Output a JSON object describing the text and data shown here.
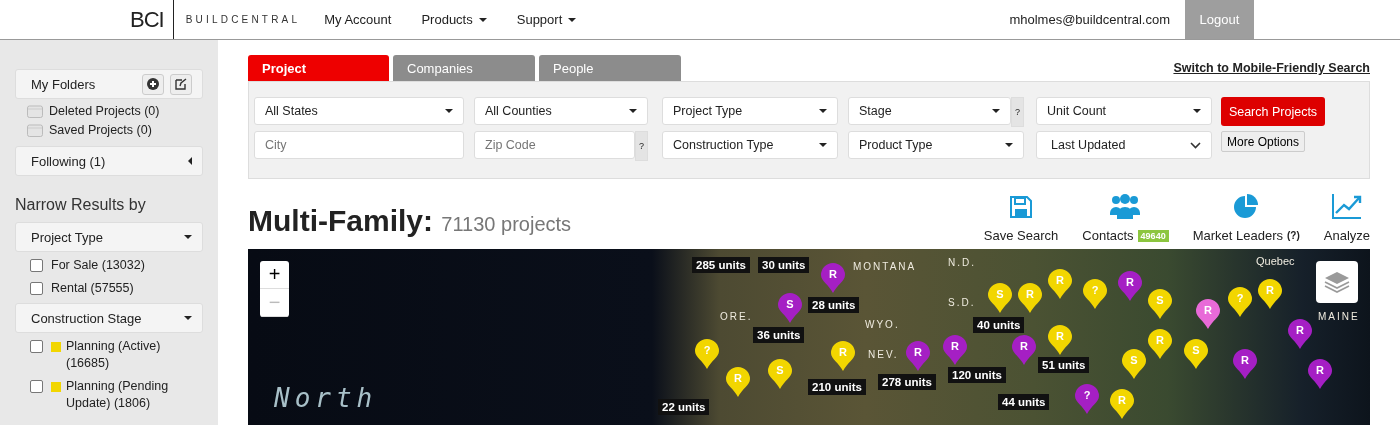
{
  "header": {
    "logo_mark": "BCI",
    "logo_text": "BUILDCENTRAL",
    "nav": [
      {
        "label": "My Account",
        "dropdown": false
      },
      {
        "label": "Products",
        "dropdown": true
      },
      {
        "label": "Support",
        "dropdown": true
      }
    ],
    "user": "mholmes@buildcentral.com",
    "logout": "Logout"
  },
  "sidebar": {
    "folders": {
      "title": "My Folders",
      "items": [
        "Deleted Projects (0)",
        "Saved Projects (0)"
      ]
    },
    "following": {
      "label": "Following (1)",
      "expanded": false
    },
    "narrow_title": "Narrow Results by",
    "groups": [
      {
        "title": "Project Type",
        "options": [
          {
            "label": "For Sale (13032)",
            "checked": false
          },
          {
            "label": "Rental (57555)",
            "checked": false
          }
        ]
      },
      {
        "title": "Construction Stage",
        "options": [
          {
            "label": "Planning (Active) (16685)",
            "checked": false,
            "color": "#f2d600"
          },
          {
            "label": "Planning (Pending Update) (1806)",
            "checked": false,
            "color": "#f2d600"
          }
        ]
      }
    ]
  },
  "tabs": [
    {
      "label": "Project",
      "selected": true
    },
    {
      "label": "Companies",
      "selected": false
    },
    {
      "label": "People",
      "selected": false
    }
  ],
  "mobile_link": "Switch to Mobile-Friendly Search",
  "filters": [
    [
      {
        "kind": "select",
        "value": "All States"
      },
      {
        "kind": "select",
        "value": "All Counties"
      },
      {
        "kind": "select",
        "value": "Project Type"
      },
      {
        "kind": "select",
        "value": "Stage",
        "help": "?"
      },
      {
        "kind": "select",
        "value": "Unit Count"
      }
    ],
    [
      {
        "kind": "input",
        "placeholder": "City"
      },
      {
        "kind": "input",
        "placeholder": "Zip Code",
        "help": "?"
      },
      {
        "kind": "select",
        "value": "Construction Type"
      },
      {
        "kind": "select",
        "value": "Product Type"
      },
      {
        "kind": "native",
        "value": "Last Updated"
      }
    ]
  ],
  "search_button": "Search Projects",
  "more_options": "More Options",
  "results": {
    "title": "Multi-Family:",
    "count": "71130 projects"
  },
  "actions": [
    {
      "kind": "save",
      "label": "Save Search"
    },
    {
      "kind": "contacts",
      "label": "Contacts",
      "badge": "49640"
    },
    {
      "kind": "leaders",
      "label": "Market Leaders",
      "hint": "(?)"
    },
    {
      "kind": "analyze",
      "label": "Analyze"
    }
  ],
  "map": {
    "zoom_in": "+",
    "zoom_out": "−",
    "places": [
      {
        "text": "North",
        "kind": "ocean"
      },
      {
        "text": "MONTANA",
        "kind": "state"
      },
      {
        "text": "N.D.",
        "kind": "state"
      },
      {
        "text": "S.D.",
        "kind": "state"
      },
      {
        "text": "WYO.",
        "kind": "state"
      },
      {
        "text": "NEV.",
        "kind": "state"
      },
      {
        "text": "ORE.",
        "kind": "state"
      },
      {
        "text": "Quebec",
        "kind": "city"
      },
      {
        "text": "MAINE",
        "kind": "state"
      }
    ],
    "labels": [
      "285 units",
      "30 units",
      "28 units",
      "36 units",
      "120 units",
      "44 units",
      "51 units",
      "278 units",
      "210 units",
      "22 units",
      "40 units"
    ],
    "pins": [
      {
        "letter": "?",
        "color": "#f2d600"
      },
      {
        "letter": "R",
        "color": "#a51fc4"
      },
      {
        "letter": "S",
        "color": "#a51fc4"
      },
      {
        "letter": "R",
        "color": "#f2d600"
      },
      {
        "letter": "R",
        "color": "#a51fc4"
      },
      {
        "letter": "R",
        "color": "#a51fc4"
      },
      {
        "letter": "S",
        "color": "#f2d600"
      },
      {
        "letter": "R",
        "color": "#f2d600"
      },
      {
        "letter": "R",
        "color": "#f2d600"
      },
      {
        "letter": "?",
        "color": "#f2d600"
      },
      {
        "letter": "R",
        "color": "#a51fc4"
      },
      {
        "letter": "S",
        "color": "#f2d600"
      },
      {
        "letter": "R",
        "color": "#e86ad8"
      },
      {
        "letter": "?",
        "color": "#f2d600"
      },
      {
        "letter": "R",
        "color": "#f2d600"
      },
      {
        "letter": "R",
        "color": "#a51fc4"
      },
      {
        "letter": "R",
        "color": "#a51fc4"
      },
      {
        "letter": "R",
        "color": "#f2d600"
      },
      {
        "letter": "S",
        "color": "#f2d600"
      },
      {
        "letter": "R",
        "color": "#a51fc4"
      },
      {
        "letter": "R",
        "color": "#f2d600"
      },
      {
        "letter": "S",
        "color": "#f2d600"
      },
      {
        "letter": "?",
        "color": "#a51fc4"
      },
      {
        "letter": "R",
        "color": "#f2d600"
      },
      {
        "letter": "S",
        "color": "#f2d600"
      },
      {
        "letter": "R",
        "color": "#f2d600"
      },
      {
        "letter": "R",
        "color": "#a51fc4"
      }
    ]
  }
}
